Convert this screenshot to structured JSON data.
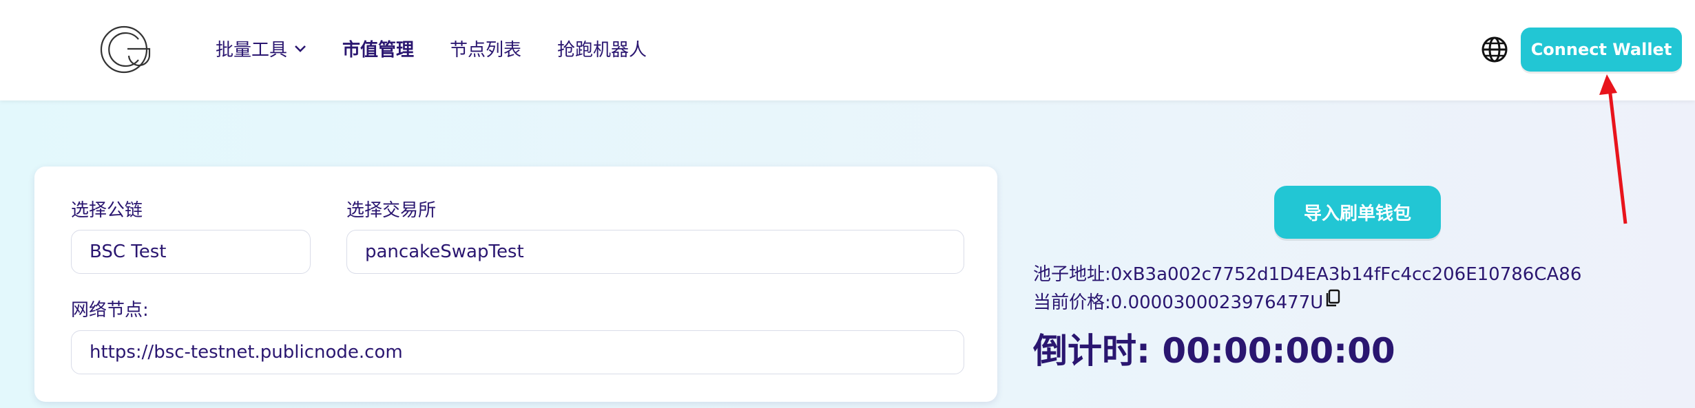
{
  "header": {
    "nav": [
      {
        "label": "批量工具",
        "has_dropdown": true
      },
      {
        "label": "市值管理",
        "active": true
      },
      {
        "label": "节点列表"
      },
      {
        "label": "抢跑机器人"
      }
    ],
    "language_icon": "globe-icon",
    "connect_label": "Connect Wallet"
  },
  "form": {
    "chain_label": "选择公链",
    "chain_value": "BSC Test",
    "exchange_label": "选择交易所",
    "exchange_value": "pancakeSwapTest",
    "node_label": "网络节点:",
    "node_value": "https://bsc-testnet.publicnode.com"
  },
  "side": {
    "import_label": "导入刷单钱包",
    "pool_address": "池子地址:0xB3a002c7752d1D4EA3b14fFc4cc206E10786CA86",
    "current_price": "当前价格:0.0000300023976477U",
    "countdown": "倒计时: 00:00:00:00"
  },
  "colors": {
    "accent": "#22c6d4",
    "text": "#2a1670",
    "annotation_arrow": "#e8141c"
  }
}
